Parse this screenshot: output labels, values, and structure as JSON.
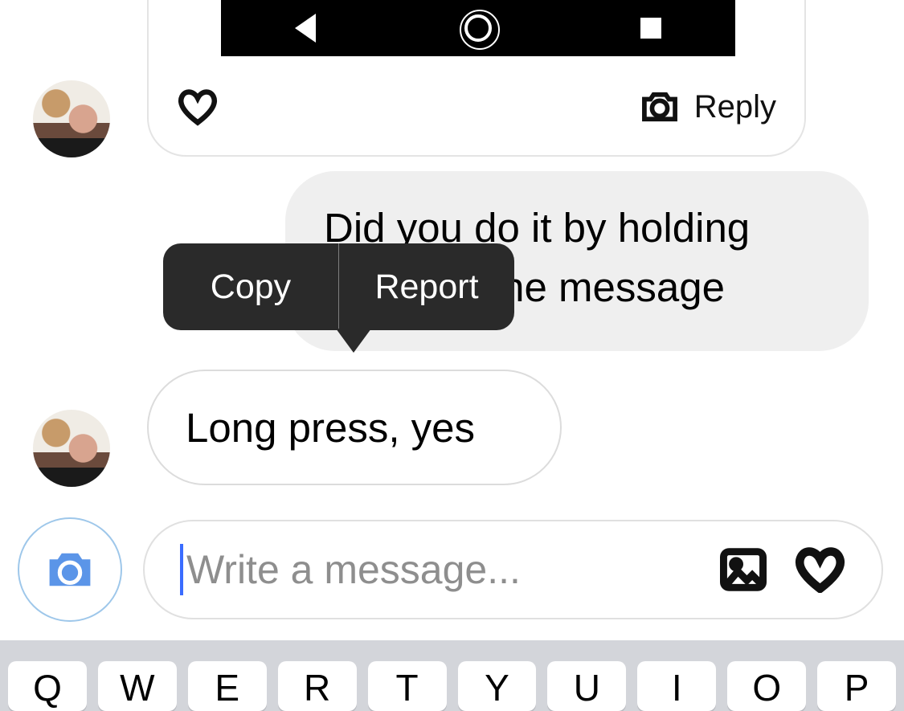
{
  "media_card": {
    "reply_label": "Reply"
  },
  "messages": {
    "outgoing": "Did you do it by holding down on the message",
    "incoming": "Long press, yes"
  },
  "context_menu": {
    "copy": "Copy",
    "report": "Report"
  },
  "composer": {
    "placeholder": "Write a message..."
  },
  "keyboard_row": [
    "Q",
    "W",
    "E",
    "R",
    "T",
    "Y",
    "U",
    "I",
    "O",
    "P"
  ]
}
